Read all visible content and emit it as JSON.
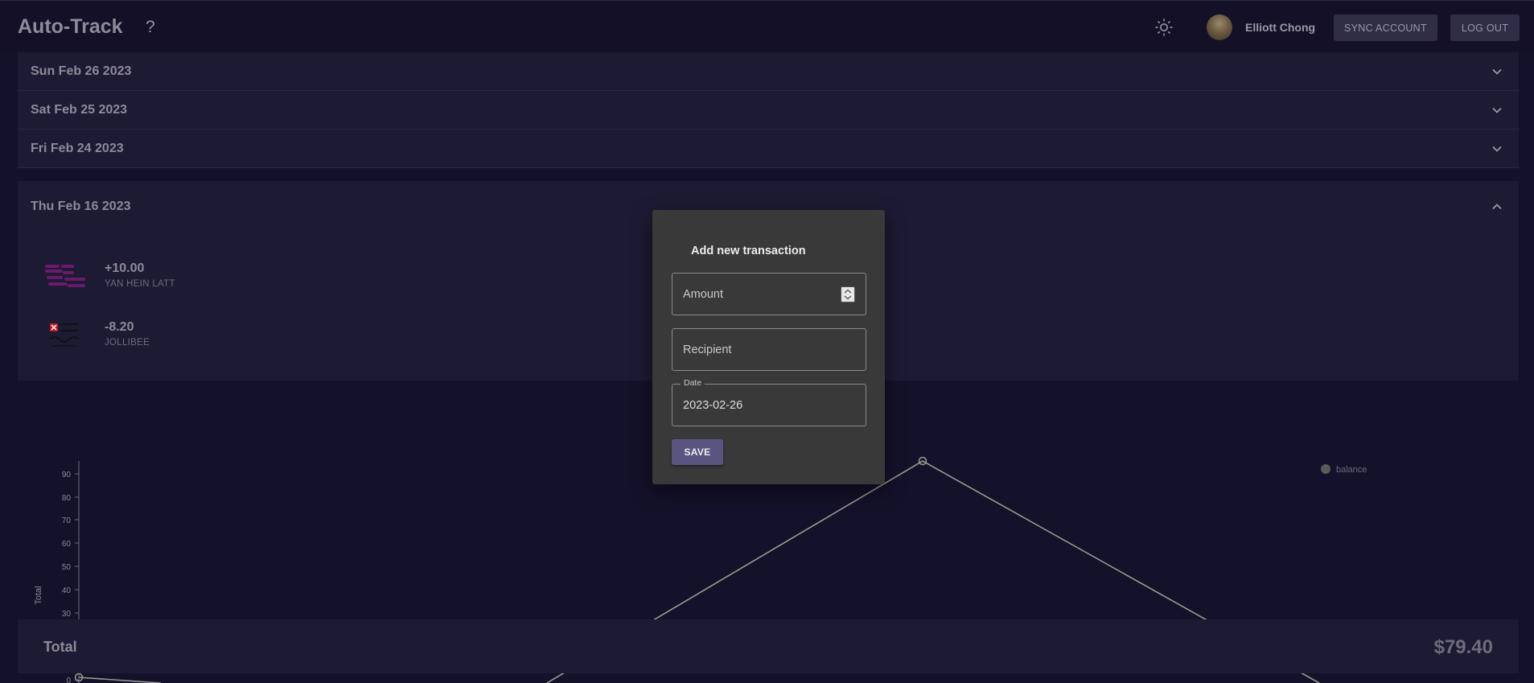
{
  "header": {
    "brand": "Auto-Track",
    "help_label": "?",
    "username": "Elliott Chong",
    "sync_label": "SYNC ACCOUNT",
    "logout_label": "LOG OUT"
  },
  "accordion": {
    "days": [
      {
        "label": "Sun Feb 26 2023",
        "expanded": false
      },
      {
        "label": "Sat Feb 25 2023",
        "expanded": false
      },
      {
        "label": "Fri Feb 24 2023",
        "expanded": false
      },
      {
        "label": "Thu Feb 16 2023",
        "expanded": true
      }
    ],
    "transactions": [
      {
        "amount": "+10.00",
        "recipient": "YAN HEIN LATT"
      },
      {
        "amount": "-8.20",
        "recipient": "JOLLIBEE"
      }
    ]
  },
  "dialog": {
    "title": "Add new transaction",
    "amount_placeholder": "Amount",
    "recipient_placeholder": "Recipient",
    "date_label": "Date",
    "date_value": "2023-02-26",
    "save_label": "SAVE"
  },
  "chart_data": {
    "type": "line",
    "ylabel": "Total",
    "yticks": [
      0,
      30,
      40,
      50,
      60,
      70,
      80,
      90
    ],
    "legend": [
      {
        "name": "balance",
        "color": "#9a9a92"
      }
    ],
    "legend_position": "top-right",
    "series": [
      {
        "name": "balance",
        "color": "#9a9a92"
      }
    ]
  },
  "total": {
    "label": "Total",
    "value": "$79.40"
  },
  "colors": {
    "background": "#14112a",
    "panel": "#1d1a33",
    "dialog": "#393939",
    "accent": "#5a5580",
    "line": "#9a9a92"
  }
}
